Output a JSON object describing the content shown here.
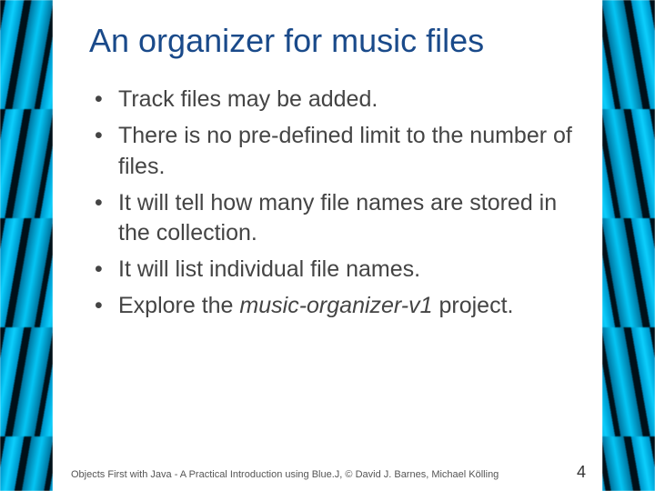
{
  "title": "An organizer for music files",
  "bullets": [
    {
      "text": "Track files may be added."
    },
    {
      "text": "There is no pre-defined limit to the number of files."
    },
    {
      "text": "It will tell how many file names are stored in the collection."
    },
    {
      "text": "It will list individual file names."
    },
    {
      "prefix": "Explore the ",
      "em": "music-organizer-v1",
      "suffix": " project."
    }
  ],
  "footer": "Objects First with Java - A Practical Introduction using Blue.J, © David J. Barnes, Michael Kölling",
  "page_number": "4"
}
